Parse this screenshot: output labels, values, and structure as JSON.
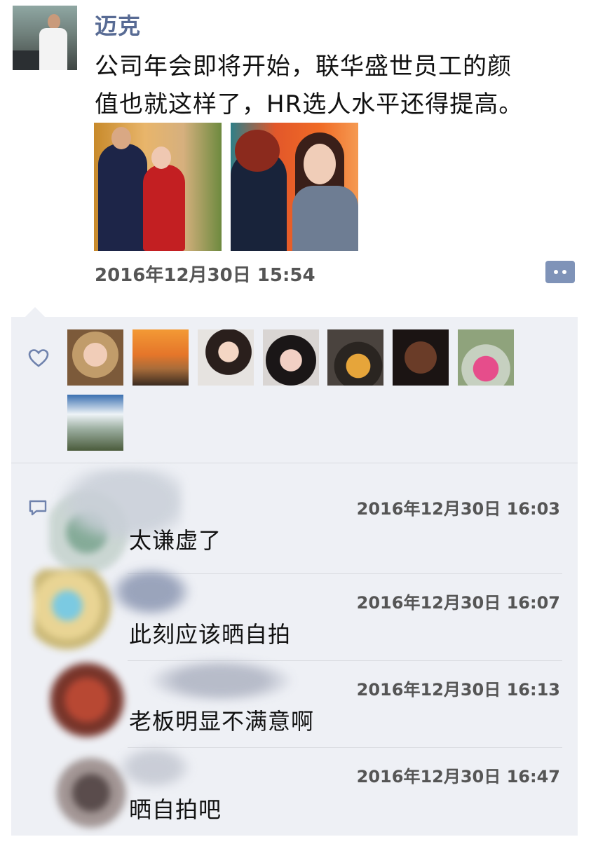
{
  "post": {
    "author": "迈克",
    "text_line1": "公司年会即将开始，联华盛世员工的颜",
    "text_line2": "值也就这样了，HR选人水平还得提高。",
    "time": "2016年12月30日 15:54"
  },
  "comments": [
    {
      "time": "2016年12月30日 16:03",
      "text": "太谦虚了"
    },
    {
      "time": "2016年12月30日 16:07",
      "text": "此刻应该晒自拍"
    },
    {
      "time": "2016年12月30日 16:13",
      "text": "老板明显不满意啊"
    },
    {
      "time": "2016年12月30日 16:47",
      "text": "晒自拍吧"
    }
  ],
  "colors": {
    "author_blue": "#586b94",
    "panel_bg": "#eef0f5",
    "comment_button": "#7f93b8"
  },
  "icons": {
    "like": "heart-outline-icon",
    "comment": "speech-bubble-icon",
    "more": "more-options-icon"
  },
  "likers_count_visible": 8
}
